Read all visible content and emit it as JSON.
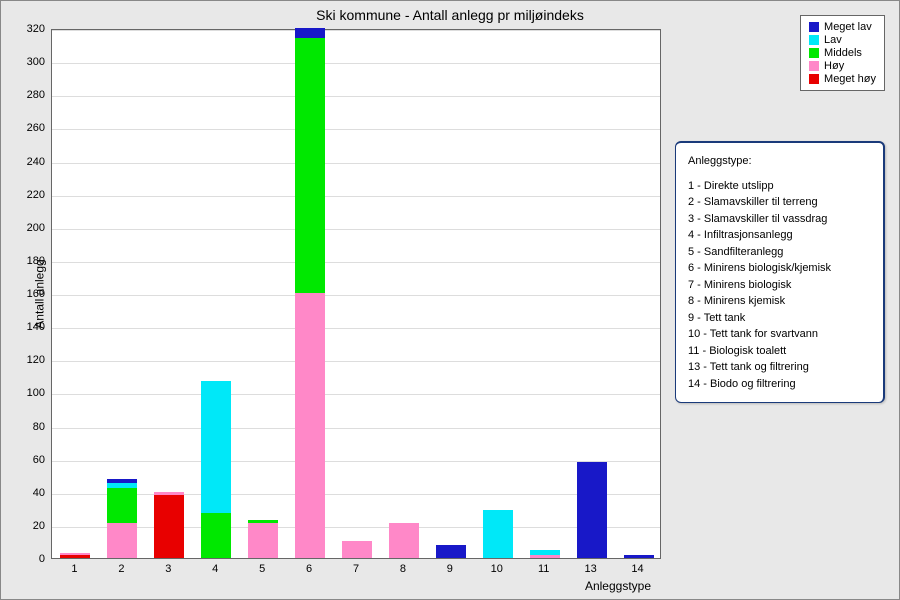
{
  "title": "Ski kommune - Antall anlegg pr miljøindeks",
  "ylabel": "Antall anlegg",
  "xlabel": "Anleggstype",
  "legend": {
    "items": [
      {
        "label": "Meget lav",
        "color": "#1818c8"
      },
      {
        "label": "Lav",
        "color": "#00e8f8"
      },
      {
        "label": "Middels",
        "color": "#00e800"
      },
      {
        "label": "Høy",
        "color": "#ff88c8"
      },
      {
        "label": "Meget høy",
        "color": "#e80000"
      }
    ]
  },
  "info": {
    "title": "Anleggstype:",
    "lines": [
      "1 - Direkte utslipp",
      "2 - Slamavskiller til terreng",
      "3 - Slamavskiller til vassdrag",
      "4 - Infiltrasjonsanlegg",
      "5 - Sandfilteranlegg",
      "6 - Minirens biologisk/kjemisk",
      "7 - Minirens biologisk",
      "8 - Minirens kjemisk",
      "9 - Tett tank",
      "10 - Tett tank for svartvann",
      "11 - Biologisk toalett",
      "13 - Tett tank og filtrering",
      "14 - Biodo og filtrering"
    ]
  },
  "chart_data": {
    "type": "bar",
    "stacked": true,
    "ylim": [
      0,
      320
    ],
    "yticks": [
      0,
      20,
      40,
      60,
      80,
      100,
      120,
      140,
      160,
      180,
      200,
      220,
      240,
      260,
      280,
      300,
      320
    ],
    "categories": [
      "1",
      "2",
      "3",
      "4",
      "5",
      "6",
      "7",
      "8",
      "9",
      "10",
      "11",
      "13",
      "14"
    ],
    "series": [
      {
        "name": "Meget høy",
        "color": "#e80000",
        "values": [
          2,
          0,
          38,
          0,
          0,
          0,
          0,
          0,
          0,
          0,
          0,
          0,
          0
        ]
      },
      {
        "name": "Høy",
        "color": "#ff88c8",
        "values": [
          1,
          21,
          2,
          0,
          21,
          160,
          10,
          21,
          0,
          0,
          2,
          0,
          0
        ]
      },
      {
        "name": "Middels",
        "color": "#00e800",
        "values": [
          0,
          21,
          0,
          27,
          2,
          154,
          0,
          0,
          0,
          0,
          0,
          0,
          0
        ]
      },
      {
        "name": "Lav",
        "color": "#00e8f8",
        "values": [
          0,
          3,
          0,
          80,
          0,
          0,
          0,
          0,
          0,
          29,
          3,
          0,
          0
        ]
      },
      {
        "name": "Meget lav",
        "color": "#1818c8",
        "values": [
          0,
          3,
          0,
          0,
          0,
          6,
          0,
          0,
          8,
          0,
          0,
          58,
          2
        ]
      }
    ]
  }
}
